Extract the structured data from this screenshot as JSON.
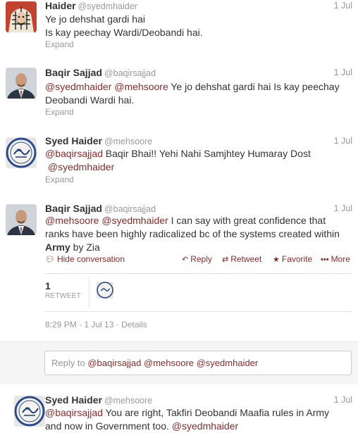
{
  "tweets": [
    {
      "name": "Haider",
      "handle": "@syedmhaider",
      "time": "1 Jul",
      "line1": "Ye jo dehshat gardi hai",
      "line2": "Is kay peechay Wardi/Deobandi hai.",
      "expand": "Expand"
    },
    {
      "name": "Baqir Sajjad",
      "handle": "@baqirsajjad",
      "time": "1 Jul",
      "mention1": "@syedmhaider",
      "mention2": "@mehsoore",
      "text1": " Ye jo dehshat gardi hai Is kay peechay",
      "line2": "Deobandi Wardi hai.",
      "expand": "Expand"
    },
    {
      "name": "Syed Haider",
      "handle": "@mehsoore",
      "time": "1 Jul",
      "mention1": "@baqirsajjad",
      "text1": " Baqir Bhai!! Yehi Nahi Samjhtey Humaray Dost",
      "mention2": "@syedmhaider",
      "expand": "Expand"
    },
    {
      "name": "Baqir Sajjad",
      "handle": "@baqirsajjad",
      "time": "1 Jul",
      "mention1": "@mehsoore",
      "mention2": "@syedmhaider",
      "text1": " I can say with great confidence that",
      "line2": "ranks have been highly radicalized bc of the systems created within",
      "bold3": "Army",
      "text3": " by Zia",
      "hide": "Hide conversation",
      "reply": "Reply",
      "retweet": "Retweet",
      "favorite": "Favorite",
      "more": "More",
      "retweet_count": "1",
      "retweet_label": "RETWEET",
      "timestamp": "8:29 PM - 1 Jul 13",
      "details": "Details",
      "reply_box_prefix": "Reply to ",
      "reply_box_mentions": "@baqirsajjad @mehsoore @syedmhaider"
    },
    {
      "name": "Syed Haider",
      "handle": "@mehsoore",
      "time": "1 Jul",
      "mention1": "@baqirsajjad",
      "text1": " You are right, Takfiri Deobandi Maafia rules in Army",
      "line2": "and now in Government too.",
      "mention2": "@syedmhaider"
    }
  ],
  "icons": {
    "hide": "speech-bubble-icon",
    "reply": "reply-arrow-icon",
    "retweet": "retweet-icon",
    "favorite": "star-icon",
    "more": "ellipsis-icon"
  },
  "colors": {
    "link": "#8b2a2a",
    "muted": "#999999",
    "text": "#333333"
  }
}
